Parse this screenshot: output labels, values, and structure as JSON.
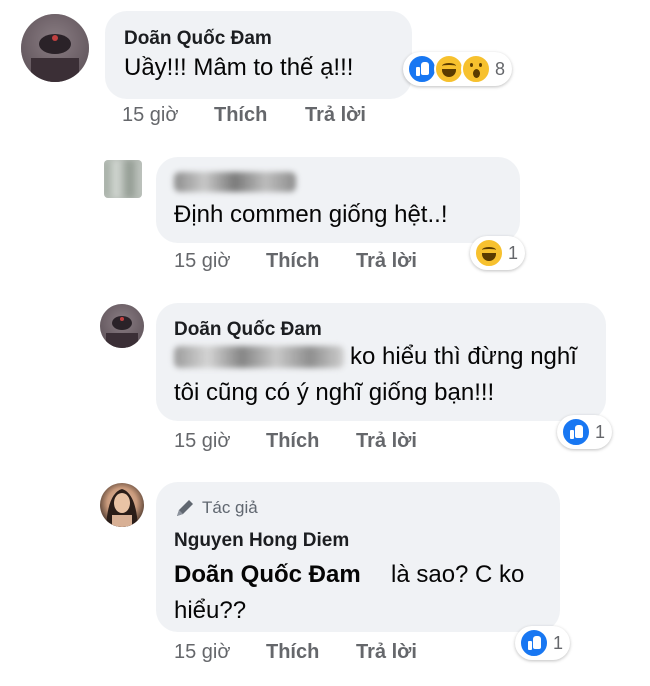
{
  "comments": [
    {
      "author": "Doãn Quốc Đam",
      "text": "Uầy!!! Mâm to thế ạ!!!",
      "time": "15 giờ",
      "like_label": "Thích",
      "reply_label": "Trả lời",
      "reaction_icons": [
        "like-icon",
        "haha-icon",
        "wow-icon"
      ],
      "reaction_count": "8"
    },
    {
      "author": "",
      "text": "Định commen giống hệt..!",
      "time": "15 giờ",
      "like_label": "Thích",
      "reply_label": "Trả lời",
      "reaction_icons": [
        "haha-icon"
      ],
      "reaction_count": "1"
    },
    {
      "author": "Doãn Quốc Đam",
      "text_line1": "ko hiểu thì đừng nghĩ",
      "text_line2": "tôi cũng có ý nghĩ giống bạn!!!",
      "time": "15 giờ",
      "like_label": "Thích",
      "reply_label": "Trả lời",
      "reaction_icons": [
        "like-icon"
      ],
      "reaction_count": "1"
    },
    {
      "author_badge": "Tác giả",
      "author": "Nguyen Hong Diem",
      "mention": "Doãn Quốc Đam",
      "text_line1": "là sao? C ko",
      "text_line2": "hiểu??",
      "time": "15 giờ",
      "like_label": "Thích",
      "reply_label": "Trả lời",
      "reaction_icons": [
        "like-icon"
      ],
      "reaction_count": "1"
    }
  ],
  "colors": {
    "bubble": "#f0f2f5",
    "meta": "#65676b",
    "like_blue": "#1877f2",
    "emoji_yellow": "#f7c12e"
  }
}
